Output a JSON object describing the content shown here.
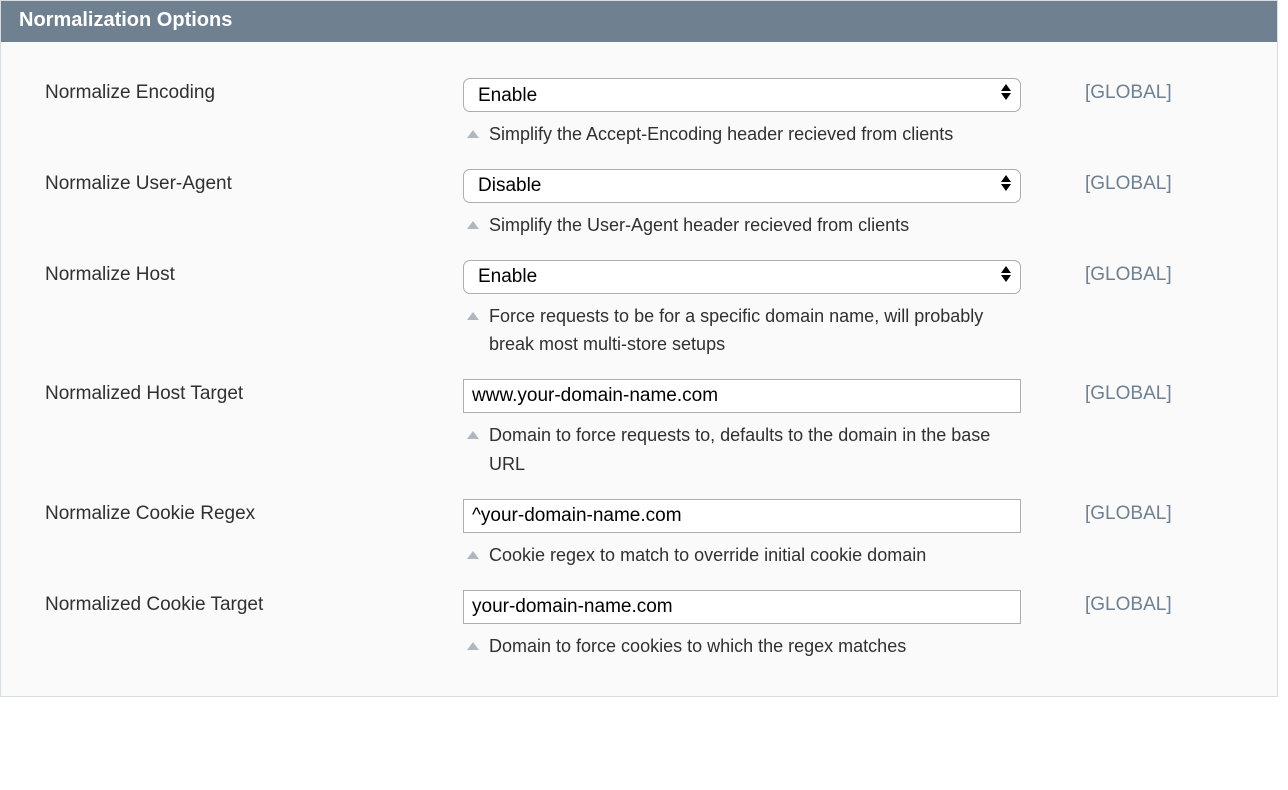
{
  "panel": {
    "title": "Normalization Options"
  },
  "fields": {
    "normalize_encoding": {
      "label": "Normalize Encoding",
      "value": "Enable",
      "help": "Simplify the Accept-Encoding header recieved from clients",
      "scope": "[GLOBAL]"
    },
    "normalize_user_agent": {
      "label": "Normalize User-Agent",
      "value": "Disable",
      "help": "Simplify the User-Agent header recieved from clients",
      "scope": "[GLOBAL]"
    },
    "normalize_host": {
      "label": "Normalize Host",
      "value": "Enable",
      "help": "Force requests to be for a specific domain name, will probably break most multi-store setups",
      "scope": "[GLOBAL]"
    },
    "normalized_host_target": {
      "label": "Normalized Host Target",
      "value": "www.your-domain-name.com",
      "help": "Domain to force requests to, defaults to the domain in the base URL",
      "scope": "[GLOBAL]"
    },
    "normalize_cookie_regex": {
      "label": "Normalize Cookie Regex",
      "value": "^your-domain-name.com",
      "help": "Cookie regex to match to override initial cookie domain",
      "scope": "[GLOBAL]"
    },
    "normalized_cookie_target": {
      "label": "Normalized Cookie Target",
      "value": "your-domain-name.com",
      "help": "Domain to force cookies to which the regex matches",
      "scope": "[GLOBAL]"
    }
  },
  "select_options": {
    "enable_disable": [
      "Enable",
      "Disable"
    ]
  }
}
